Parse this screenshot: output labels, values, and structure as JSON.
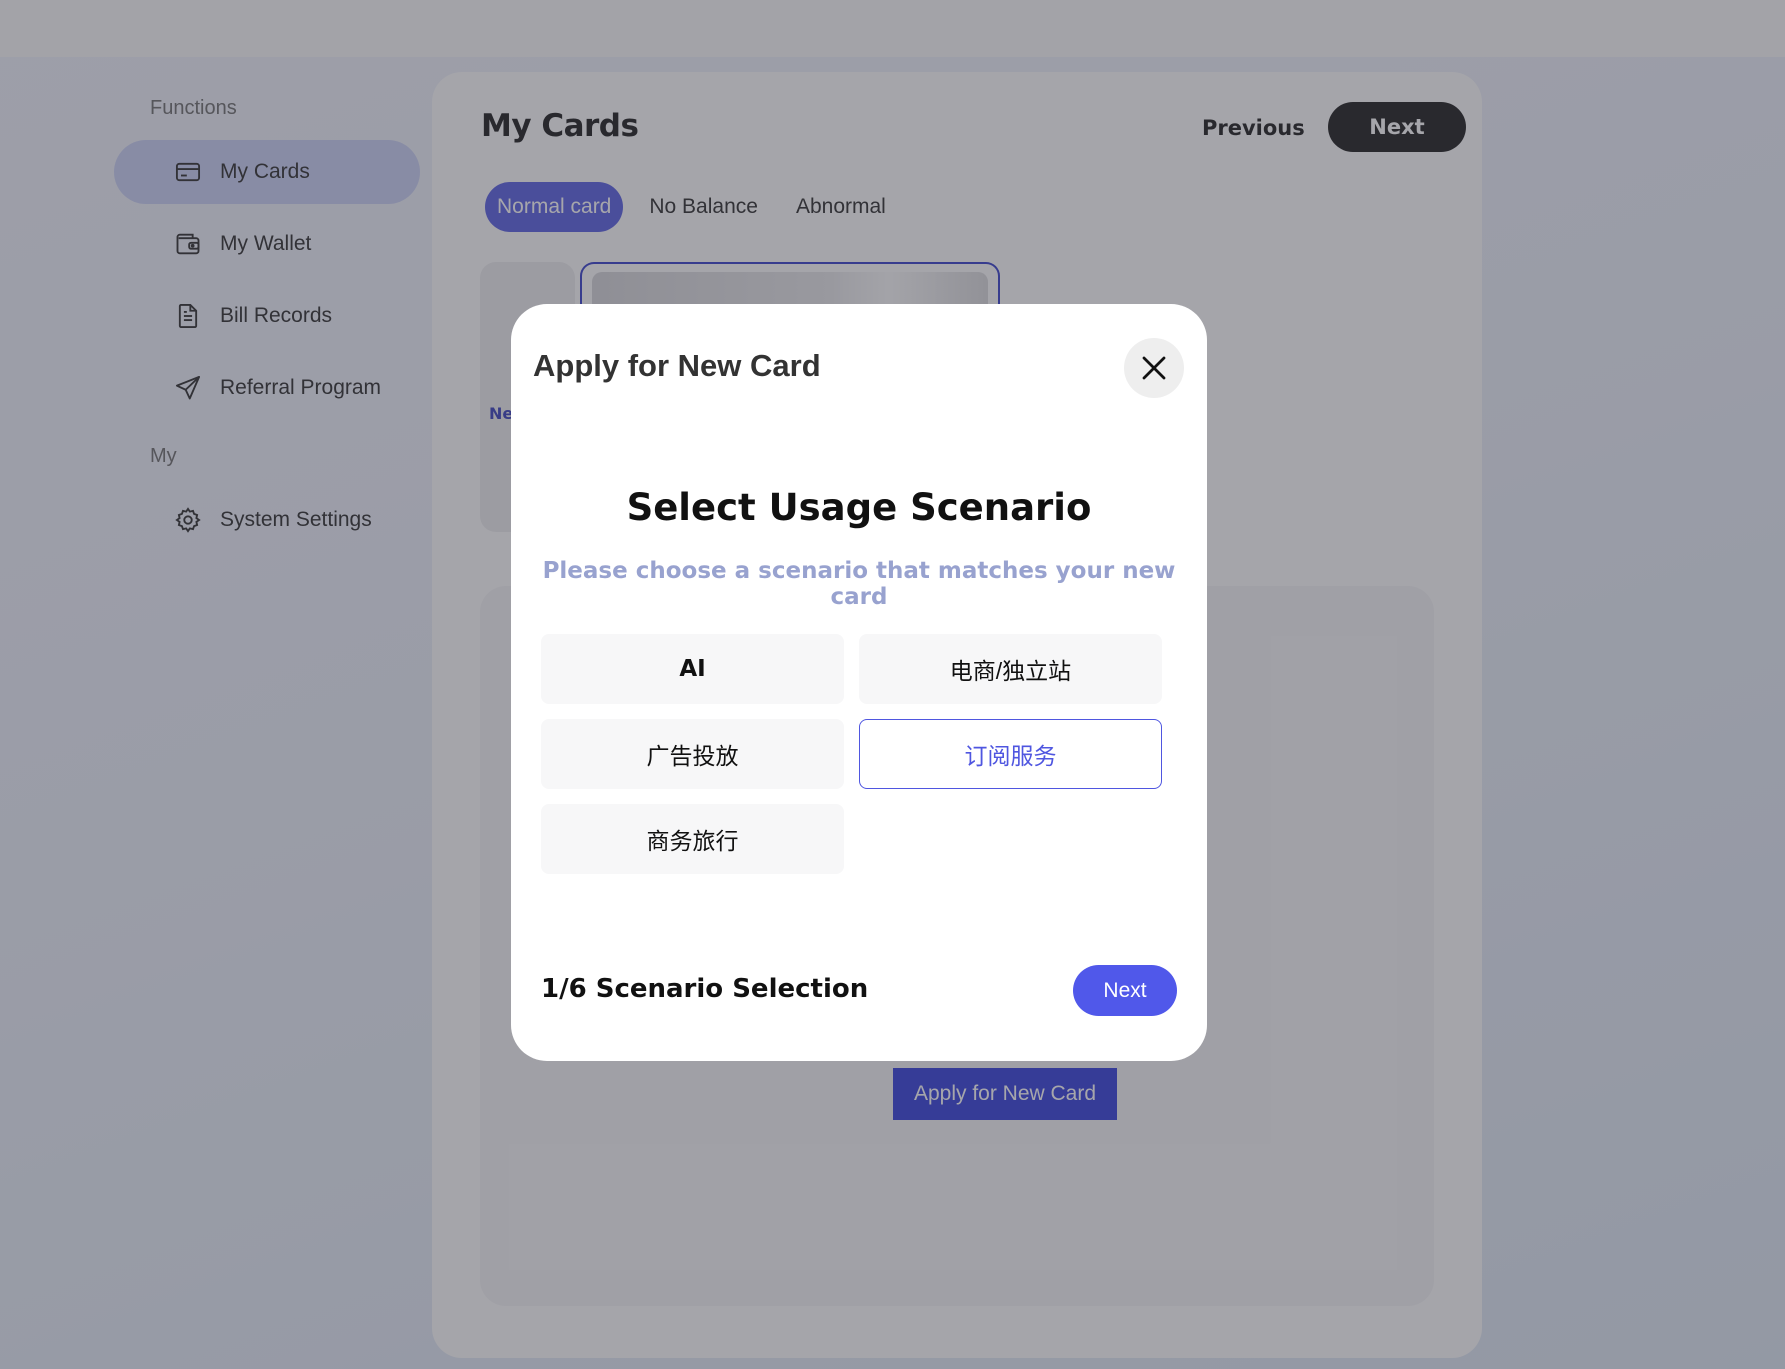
{
  "sidebar": {
    "sections": [
      {
        "title": "Functions",
        "items": [
          {
            "label": "My Cards",
            "icon": "credit-card-icon",
            "active": true
          },
          {
            "label": "My Wallet",
            "icon": "wallet-icon",
            "active": false
          },
          {
            "label": "Bill Records",
            "icon": "document-icon",
            "active": false
          },
          {
            "label": "Referral Program",
            "icon": "paper-plane-icon",
            "active": false
          }
        ]
      },
      {
        "title": "My",
        "items": [
          {
            "label": "System Settings",
            "icon": "gear-icon",
            "active": false
          }
        ]
      }
    ]
  },
  "main": {
    "title": "My Cards",
    "previous_label": "Previous",
    "next_label": "Next",
    "tabs": [
      {
        "label": "Normal card",
        "active": true
      },
      {
        "label": "No Balance",
        "active": false
      },
      {
        "label": "Abnormal",
        "active": false
      }
    ],
    "card_left_label": "Ne",
    "apply_label": "Apply for New Card"
  },
  "modal": {
    "title": "Apply for New Card",
    "heading": "Select Usage Scenario",
    "subheading": "Please choose a scenario that matches your new card",
    "options": [
      {
        "label": "AI",
        "selected": false
      },
      {
        "label": "电商/独立站",
        "selected": false
      },
      {
        "label": "广告投放",
        "selected": false
      },
      {
        "label": "订阅服务",
        "selected": true
      },
      {
        "label": "商务旅行",
        "selected": false
      }
    ],
    "step": "1/6 Scenario Selection",
    "next_label": "Next"
  },
  "colors": {
    "accent": "#4f56e0",
    "sidebar_active": "#c6cef4",
    "subheading": "#98a2cf"
  }
}
